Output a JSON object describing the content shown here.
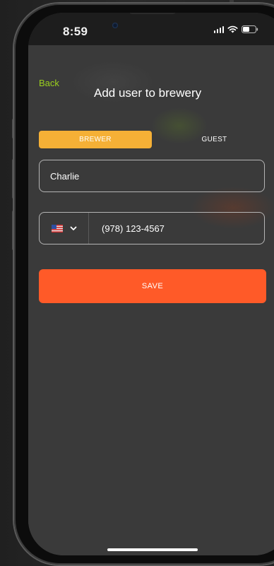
{
  "status_bar": {
    "time": "8:59",
    "icons": [
      "signal-icon",
      "wifi-icon",
      "battery-icon"
    ]
  },
  "header": {
    "back_label": "Back",
    "title": "Add user to brewery"
  },
  "role_toggle": {
    "options": [
      {
        "label": "BREWER",
        "selected": true
      },
      {
        "label": "GUEST",
        "selected": false
      }
    ]
  },
  "form": {
    "name_value": "Charlie",
    "country_flag": "us-flag-icon",
    "phone_value": "(978) 123-4567"
  },
  "actions": {
    "save_label": "SAVE"
  },
  "colors": {
    "accent_back": "#9bcf1e",
    "toggle_active": "#f5b036",
    "save_button": "#ff5a28",
    "screen_bg": "#3a3a3a"
  }
}
